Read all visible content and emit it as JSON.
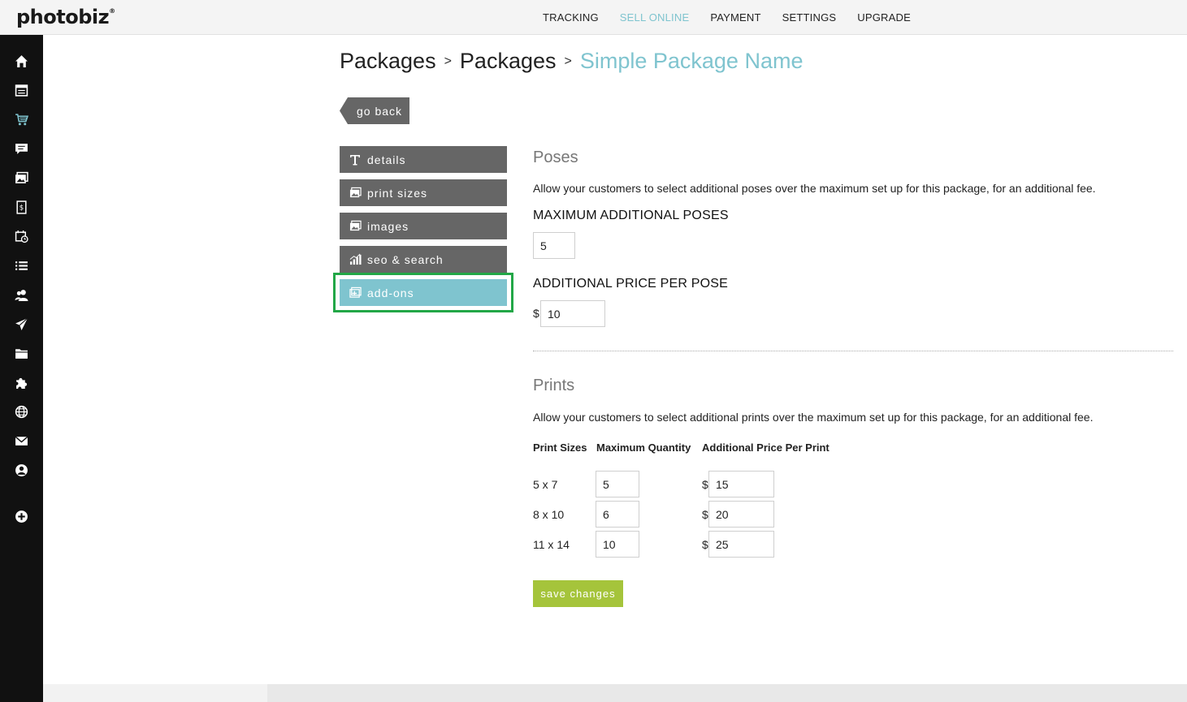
{
  "brand": {
    "logo_text": "photobiz",
    "logo_mark": "®"
  },
  "topnav": {
    "items": [
      {
        "label": "TRACKING",
        "active": false
      },
      {
        "label": "SELL ONLINE",
        "active": true
      },
      {
        "label": "PAYMENT",
        "active": false
      },
      {
        "label": "SETTINGS",
        "active": false
      },
      {
        "label": "UPGRADE",
        "active": false
      }
    ]
  },
  "sidebar": {
    "icons": [
      "home-icon",
      "calendar-list-icon",
      "cart-icon",
      "chat-icon",
      "gallery-icon",
      "invoice-icon",
      "schedule-icon",
      "list-icon",
      "contacts-icon",
      "send-icon",
      "folder-icon",
      "puzzle-icon",
      "globe-icon",
      "mail-icon",
      "account-icon",
      "add-circle-icon"
    ],
    "active_icon": "cart-icon",
    "active_color": "#7fc4cf"
  },
  "breadcrumb": {
    "items": [
      "Packages",
      "Packages"
    ],
    "separator": ">",
    "current": "Simple Package Name"
  },
  "go_back": {
    "label": "go back"
  },
  "side_menu": {
    "items": [
      {
        "label": "details",
        "icon": "text-icon",
        "active": false
      },
      {
        "label": "print sizes",
        "icon": "image-icon",
        "active": false
      },
      {
        "label": "images",
        "icon": "image-icon",
        "active": false
      },
      {
        "label": "seo & search",
        "icon": "signal-icon",
        "active": false
      },
      {
        "label": "add-ons",
        "icon": "addons-icon",
        "active": true
      }
    ]
  },
  "poses": {
    "title": "Poses",
    "description": "Allow your customers to select additional poses over the maximum set up for this package, for an additional fee.",
    "max_label": "MAXIMUM ADDITIONAL POSES",
    "max_value": "5",
    "price_label": "ADDITIONAL PRICE PER POSE",
    "currency": "$",
    "price_value": "10"
  },
  "prints": {
    "title": "Prints",
    "description": "Allow your customers to select additional prints over the maximum set up for this package, for an additional fee.",
    "columns": [
      "Print Sizes",
      "Maximum Quantity",
      "Additional Price Per Print"
    ],
    "currency": "$",
    "rows": [
      {
        "size": "5 x 7",
        "max_qty": "5",
        "price": "15"
      },
      {
        "size": "8 x 10",
        "max_qty": "6",
        "price": "20"
      },
      {
        "size": "11 x 14",
        "max_qty": "10",
        "price": "25"
      }
    ]
  },
  "save_button": {
    "label": "save changes"
  },
  "colors": {
    "accent": "#7fc4cf",
    "menu_bg": "#666666",
    "save_green": "#a5c43b",
    "highlight_green": "#22a747"
  }
}
